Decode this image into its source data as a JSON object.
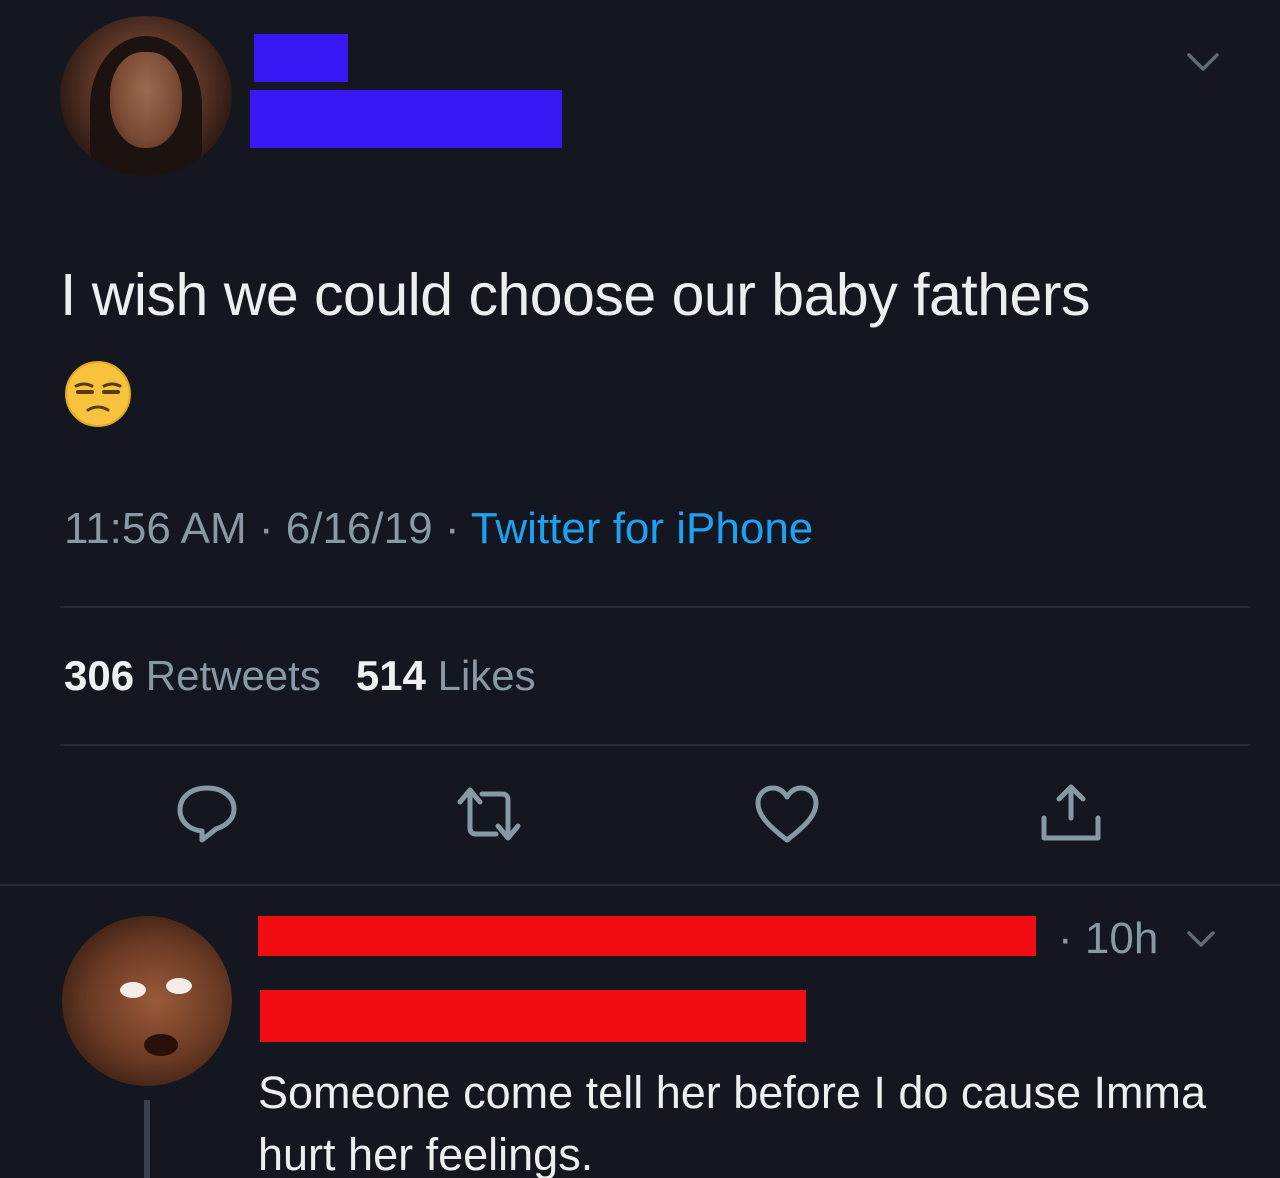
{
  "tweet": {
    "text": "I wish we could choose our baby fathers",
    "emoji": "unamused-face",
    "time": "11:56 AM",
    "date": "6/16/19",
    "source": "Twitter for iPhone",
    "retweets_count": "306",
    "retweets_label": "Retweets",
    "likes_count": "514",
    "likes_label": "Likes"
  },
  "actions": [
    {
      "icon": "reply-icon"
    },
    {
      "icon": "retweet-icon"
    },
    {
      "icon": "like-icon"
    },
    {
      "icon": "share-icon"
    }
  ],
  "reply": {
    "time": "10h",
    "text": "Someone come tell her before I do cause Imma hurt her feelings."
  },
  "colors": {
    "background": "#14171f",
    "redact_blue": "#3a18f6",
    "redact_red": "#f20d12",
    "link": "#1da1f2",
    "muted": "#8899a6"
  }
}
